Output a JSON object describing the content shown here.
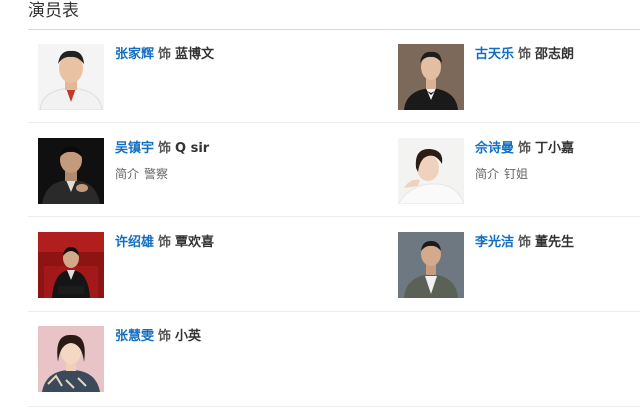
{
  "section": {
    "title": "演员表"
  },
  "plays_word": "饰",
  "cast": [
    {
      "actor": "张家辉",
      "role": "蓝博文",
      "intro_label": "",
      "intro": ""
    },
    {
      "actor": "古天乐",
      "role": "邵志朗",
      "intro_label": "",
      "intro": ""
    },
    {
      "actor": "吴镇宇",
      "role": "Q sir",
      "intro_label": "简介",
      "intro": "警察"
    },
    {
      "actor": "佘诗曼",
      "role": "丁小嘉",
      "intro_label": "简介",
      "intro": "钉姐"
    },
    {
      "actor": "许绍雄",
      "role": "覃欢喜",
      "intro_label": "",
      "intro": ""
    },
    {
      "actor": "李光洁",
      "role": "董先生",
      "intro_label": "",
      "intro": ""
    },
    {
      "actor": "张慧雯",
      "role": "小英",
      "intro_label": "",
      "intro": ""
    }
  ],
  "colors": {
    "actor_link": "#136ec2",
    "rule": "#d9d9d9"
  }
}
